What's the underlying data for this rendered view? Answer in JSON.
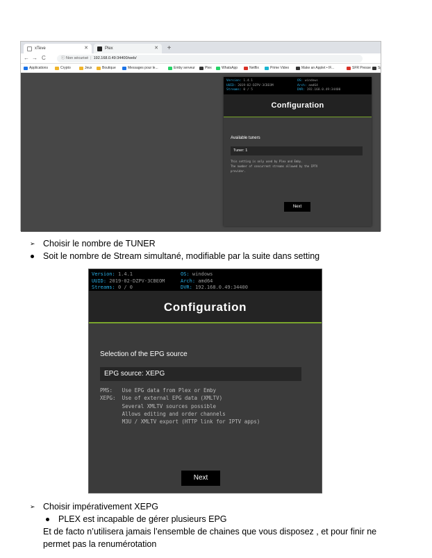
{
  "browser": {
    "tabs": [
      {
        "label": "xTeve",
        "active": true
      },
      {
        "label": "Plex",
        "active": false
      }
    ],
    "new_tab": "+",
    "nav": {
      "back": "←",
      "forward": "→",
      "reload": "C"
    },
    "address": {
      "security": "Non sécurisé",
      "url": "192.168.0.49:34400/web/"
    },
    "bookmarks": [
      "Applications",
      "Crypto",
      "Jeux",
      "Boutique",
      "Messages pour le...",
      "Emby serveur",
      "Plex",
      "WhatsApp",
      "Netflix",
      "Prime Video",
      "Make an Applet • IF...",
      "SFR Presse",
      "Sp"
    ]
  },
  "panel1": {
    "status": [
      {
        "key": "Version:",
        "value": "1.4.1",
        "key2": "OS:",
        "value2": "windows"
      },
      {
        "key": "UUID:",
        "value": "2019-02-DZPV-3CBEOM",
        "key2": "Arch:",
        "value2": "amd64"
      },
      {
        "key": "Streams:",
        "value": "0 / 5",
        "key2": "DVR:",
        "value2": "192.168.0.49:34400"
      }
    ],
    "heading": "Configuration",
    "section_title": "Available tuners",
    "field_value": "Tuner: 1",
    "description": [
      "This setting is only used by Plex and Emby.",
      "The number of concurrent streams allowed by the IPTV",
      "provider."
    ],
    "next_label": "Next"
  },
  "doc": {
    "bullet1": "Choisir le nombre de TUNER",
    "bullet2": "Soit le nombre de Stream simultané, modifiable par la suite dans setting",
    "bullet3": "Choisir impérativement XEPG",
    "bullet4": "PLEX est incapable de gérer plusieurs EPG",
    "para_line1": "Et de facto n’utilisera jamais l’ensemble de chaines que vous disposez , et pour finir ne",
    "para_line2": "permet pas la renumérotation"
  },
  "panel2": {
    "status": [
      {
        "key": "Version:",
        "value": "1.4.1",
        "key2": "OS:",
        "value2": "windows"
      },
      {
        "key": "UUID:",
        "value": "2019-02-DZPV-3CBEOM",
        "key2": "Arch:",
        "value2": "amd64"
      },
      {
        "key": "Streams:",
        "value": "0 / 0",
        "key2": "DVR:",
        "value2": "192.168.0.49:34400"
      }
    ],
    "heading": "Configuration",
    "section_title": "Selection of the EPG source",
    "field_value": "EPG source: XEPG",
    "description": "PMS:   Use EPG data from Plex or Emby\nXEPG:  Use of external EPG data (XMLTV)\n       Several XMLTV sources possible\n       Allows editing and order channels\n       M3U / XMLTV export (HTTP link for IPTV apps)",
    "next_label": "Next"
  },
  "colors": {
    "accent_green": "#7aa62c",
    "status_key_blue": "#29b0e8",
    "panel_bg": "#3b3b3b"
  }
}
